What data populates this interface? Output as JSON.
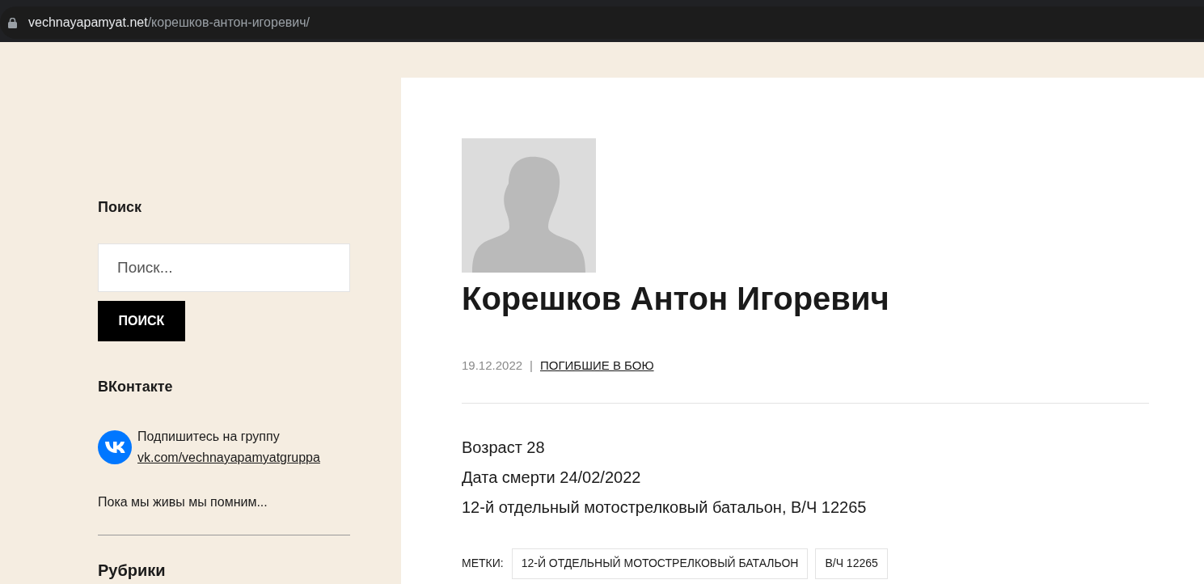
{
  "address_bar": {
    "domain": "vechnayapamyat.net",
    "path": "/корешков-антон-игоревич/"
  },
  "sidebar": {
    "search_title": "Поиск",
    "search_placeholder": "Поиск...",
    "search_button": "ПОИСК",
    "vk_title": "ВКонтакте",
    "vk_text": "Подпишитесь на группу",
    "vk_link": "vk.com/vechnayapamyatgruppa",
    "motto": "Пока мы живы мы помним...",
    "rubrics_title": "Рубрики"
  },
  "post": {
    "title": "Корешков Антон Игоревич",
    "date": "19.12.2022",
    "separator": "|",
    "category": "ПОГИБШИЕ В БОЮ",
    "lines": [
      "Возраст 28",
      "Дата смерти 24/02/2022",
      "12-й отдельный мотострелковый батальон, В/Ч 12265"
    ],
    "tags_label": "МЕТКИ:",
    "tags": [
      "12-Й ОТДЕЛЬНЫЙ МОТОСТРЕЛКОВЫЙ БАТАЛЬОН",
      "В/Ч 12265"
    ]
  }
}
